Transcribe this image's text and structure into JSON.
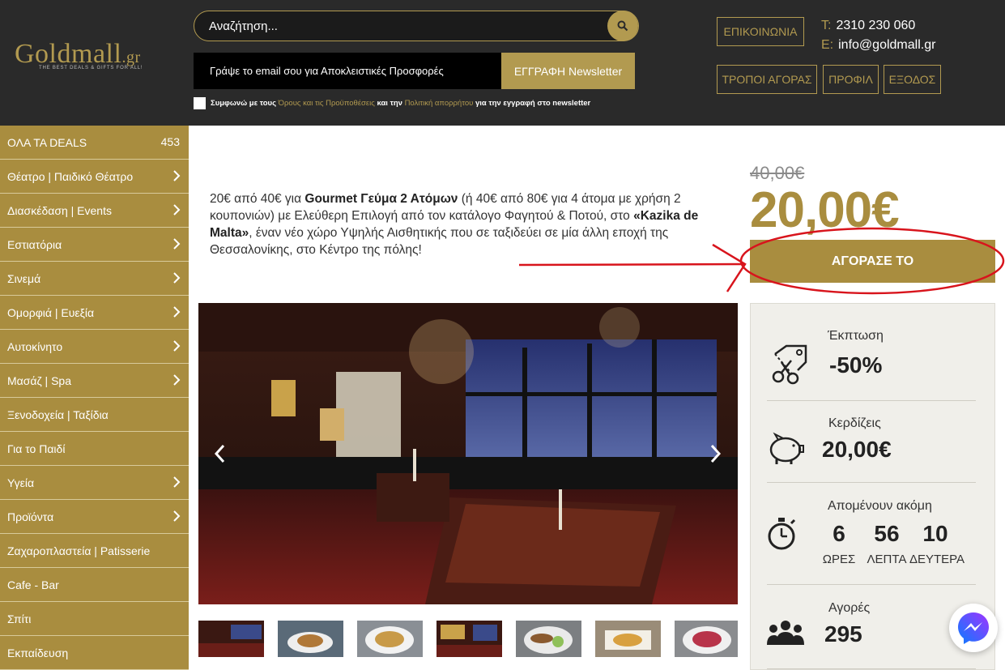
{
  "header": {
    "logo_main": "Goldmall",
    "logo_suffix": ".gr",
    "logo_tagline": "THE BEST DEALS & GIFTS FOR ALL!",
    "search_placeholder": "Αναζήτηση...",
    "newsletter_placeholder": "Γράψε το email σου για Αποκλειστικές Προσφορές",
    "newsletter_button": "ΕΓΓΡΑΦΗ Newsletter",
    "agree_prefix": "Συμφωνώ με τους",
    "agree_terms": "Όρους και τις Προϋποθέσεις",
    "agree_and": "και την",
    "agree_privacy": "Πολιτική απορρήτου",
    "agree_suffix": "για την εγγραφή στο newsletter",
    "contact_button": "ΕΠΙΚΟΙΝΩΝΙΑ",
    "ways_button": "ΤΡΟΠΟΙ ΑΓΟΡΑΣ",
    "profile_button": "ΠΡΟΦΙΛ",
    "logout_button": "ΕΞΟΔΟΣ",
    "phone_label": "T:",
    "phone": "2310 230 060",
    "email_label": "E:",
    "email": "info@goldmall.gr"
  },
  "sidebar": {
    "all_deals_label": "ΟΛΑ ΤΑ DEALS",
    "all_deals_count": "453",
    "items": [
      {
        "label": "Θέατρο | Παιδικό Θέατρο",
        "chevron": true
      },
      {
        "label": "Διασκέδαση | Events",
        "chevron": true
      },
      {
        "label": "Εστιατόρια",
        "chevron": true
      },
      {
        "label": "Σινεμά",
        "chevron": true
      },
      {
        "label": "Ομορφιά | Ευεξία",
        "chevron": true
      },
      {
        "label": "Αυτοκίνητο",
        "chevron": true
      },
      {
        "label": "Μασάζ | Spa",
        "chevron": true
      },
      {
        "label": "Ξενοδοχεία | Ταξίδια",
        "chevron": false
      },
      {
        "label": "Για το Παιδί",
        "chevron": false
      },
      {
        "label": "Υγεία",
        "chevron": true
      },
      {
        "label": "Προϊόντα",
        "chevron": true
      },
      {
        "label": "Ζαχαροπλαστεία | Patisserie",
        "chevron": false
      },
      {
        "label": "Cafe - Bar",
        "chevron": false
      },
      {
        "label": "Σπίτι",
        "chevron": false
      },
      {
        "label": "Εκπαίδευση",
        "chevron": false
      }
    ]
  },
  "deal": {
    "desc_1": "20€ από 40€ για ",
    "desc_2": "Gourmet Γεύμα 2 Ατόμων",
    "desc_3": " (ή 40€ από 80€ για 4 άτομα με χρήση 2 κουπονιών) με Ελεύθερη Επιλογή από τον κατάλογο Φαγητού & Ποτού, στο ",
    "desc_4": "«Kazika de Malta»",
    "desc_5": ", έναν νέο χώρο Υψηλής Αισθητικής που σε ταξιδεύει σε μία άλλη εποχή της Θεσσαλονίκης, στο Κέντρο της πόλης!",
    "old_price": "40,00€",
    "new_price": "20,00€",
    "buy_button": "ΑΓΟΡΑΣΕ ΤΟ"
  },
  "info": {
    "discount_label": "Έκπτωση",
    "discount_value": "-50%",
    "save_label": "Κερδίζεις",
    "save_value": "20,00€",
    "remaining_label": "Απομένουν ακόμη",
    "hours": "6",
    "hours_unit": "ΩΡΕΣ",
    "minutes": "56",
    "minutes_unit": "ΛΕΠΤΑ",
    "seconds": "10",
    "seconds_unit": "ΔΕΥΤΕΡΑ",
    "purchases_label": "Αγορές",
    "purchases_value": "295"
  },
  "colors": {
    "gold": "#a98d3f",
    "dark": "#2a2a2a",
    "annotation_red": "#d8141c"
  },
  "icons": [
    "search-icon",
    "chevron-right-icon",
    "price-tag-scissors-icon",
    "piggy-bank-icon",
    "stopwatch-icon",
    "people-icon",
    "messenger-icon"
  ]
}
